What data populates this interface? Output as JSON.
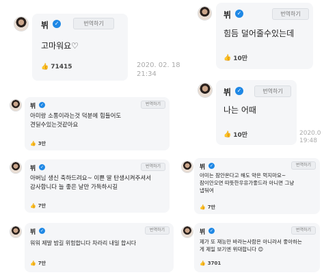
{
  "posts": [
    {
      "author": "뷔",
      "translate": "번역하기",
      "text": "고마워요♡",
      "likes": "71415",
      "time": "2020. 02. 18\n21:34"
    },
    {
      "author": "뷔",
      "translate": "번역하기",
      "text": "힘듬 덜어줄수있는데",
      "likes": "10만"
    },
    {
      "author": "뷔",
      "translate": "번역하기",
      "text": "나는 어때",
      "likes": "10만",
      "time": "2020.0\n19:48"
    },
    {
      "author": "뷔",
      "translate": "번역하기",
      "text": "아미랑 소통이라는것 덕분에 힘들어도\n견딜수있는것같아요",
      "likes": "3만"
    },
    {
      "author": "뷔",
      "translate": "번역하기",
      "text": "아버님 생신 축하드려요~ 이쁜 딸 탄생시켜주셔서\n감사합니다 늘 좋은 날만 가득하시길",
      "likes": "7만"
    },
    {
      "author": "뷔",
      "translate": "번역하기",
      "text": "아미는 잠안온다고 해도 약은 먹지마요~\n잠이안오면 따뜻한우유가좋드라 아니면 그냥\n냅둬여",
      "likes": "7만"
    },
    {
      "author": "뷔",
      "translate": "번역하기",
      "text": "워워 제발 밤길 위험합니다 차라리 내일 합시다",
      "likes": "7만"
    },
    {
      "author": "뷔",
      "translate": "번역하기",
      "text": "제가 또 재능만 바라는사람은 아니라서 좋아하는\n게 제일 보기엔 위대합니다 😊",
      "likes": "3701"
    }
  ],
  "icons": {
    "verified": "verified-badge-icon",
    "like": "thumbs-up-icon",
    "avatar": "profile-avatar"
  },
  "colors": {
    "verified": "#1f88e5",
    "card": "#f5f6f8"
  }
}
